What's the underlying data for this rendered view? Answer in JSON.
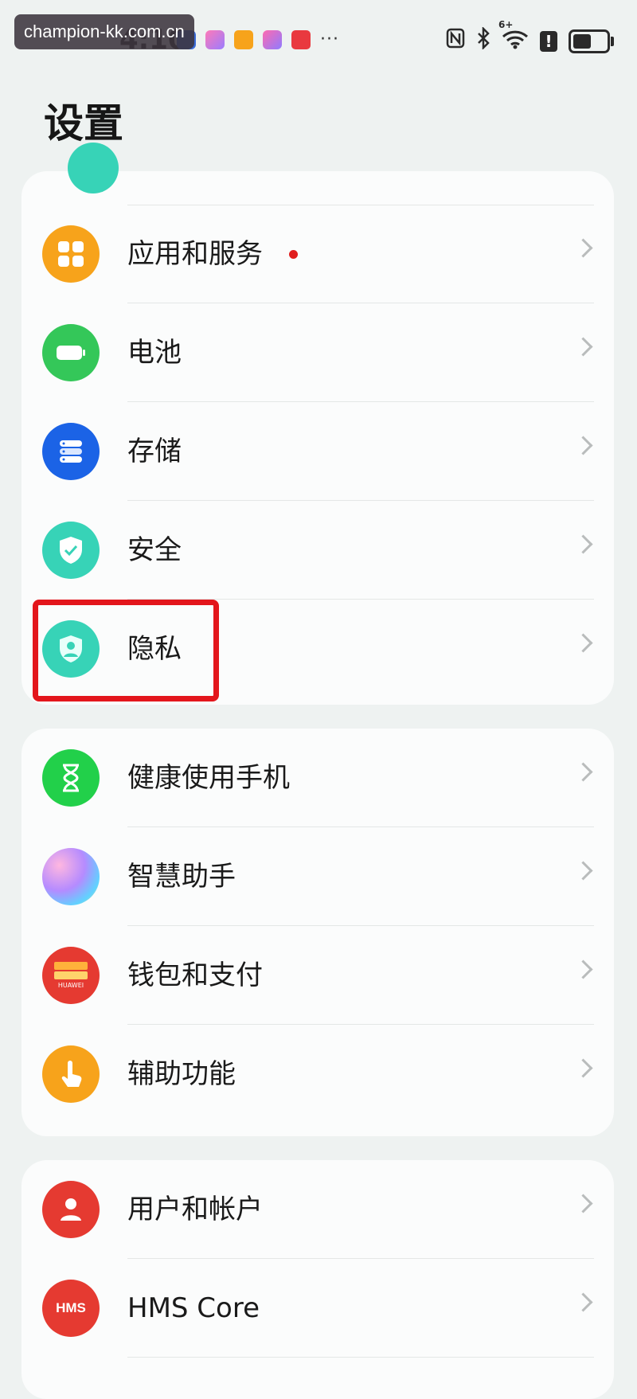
{
  "status_bar": {
    "time": "4:10",
    "watermark": "champion-kk.com.cn",
    "more": "···",
    "signal_label": "6+"
  },
  "page": {
    "title": "设置"
  },
  "sections": [
    {
      "items": [
        {
          "label": "应用和服务",
          "icon": "apps-icon",
          "color": "#f7a31b",
          "badge": true
        },
        {
          "label": "电池",
          "icon": "battery-icon",
          "color": "#34c759"
        },
        {
          "label": "存储",
          "icon": "storage-icon",
          "color": "#1b63e6"
        },
        {
          "label": "安全",
          "icon": "shield-check-icon",
          "color": "#37d3b7"
        },
        {
          "label": "隐私",
          "icon": "privacy-shield-icon",
          "color": "#37d3b7",
          "highlighted": true
        }
      ]
    },
    {
      "items": [
        {
          "label": "健康使用手机",
          "icon": "hourglass-icon",
          "color": "#22d04a"
        },
        {
          "label": "智慧助手",
          "icon": "assistant-icon",
          "color": "#b58bff"
        },
        {
          "label": "钱包和支付",
          "icon": "wallet-icon",
          "color": "#e53a31",
          "sub": "HUAWEI"
        },
        {
          "label": "辅助功能",
          "icon": "hand-touch-icon",
          "color": "#f7a31b"
        }
      ]
    },
    {
      "items": [
        {
          "label": "用户和帐户",
          "icon": "user-icon",
          "color": "#e53a31"
        },
        {
          "label": "HMS Core",
          "icon": "hms-icon",
          "color": "#e53a31",
          "sub": "HMS"
        }
      ]
    }
  ],
  "colors": {
    "highlight": "#e3161c",
    "background": "#eef2f1"
  }
}
